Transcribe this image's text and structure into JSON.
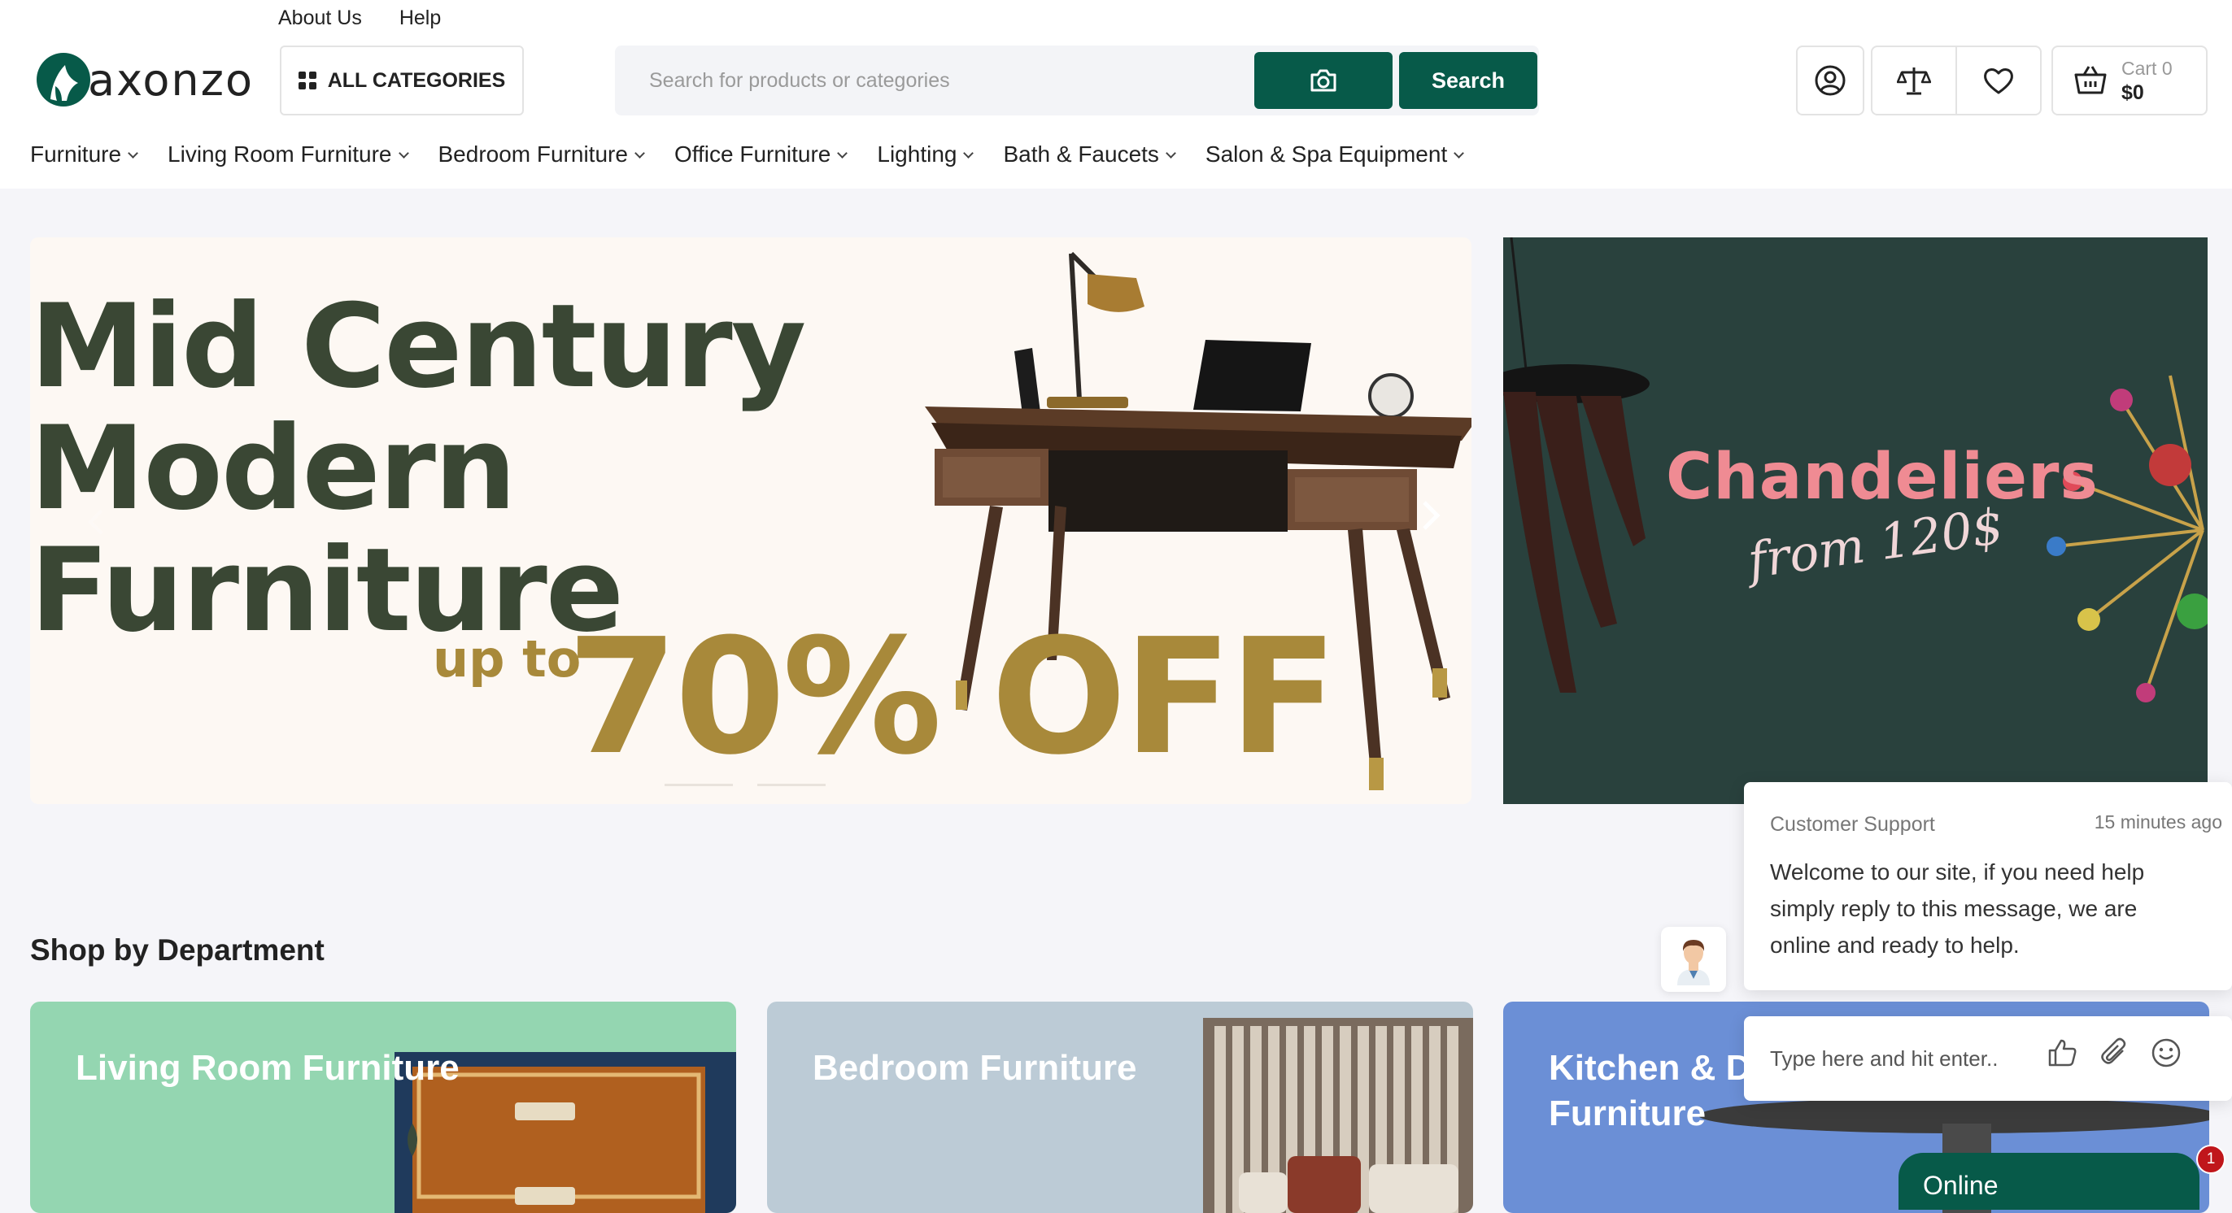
{
  "top_links": {
    "about": "About Us",
    "help": "Help"
  },
  "logo": {
    "text": "axonzo",
    "icon": "logo-mark-icon"
  },
  "all_categories": {
    "label": "ALL CATEGORIES",
    "icon": "grid-icon"
  },
  "search": {
    "placeholder": "Search for products or categories",
    "camera_icon": "camera-icon",
    "button_label": "Search"
  },
  "header_icons": {
    "account": "user-icon",
    "compare": "scale-icon",
    "wishlist": "heart-icon"
  },
  "cart": {
    "count_label": "Cart 0",
    "total": "$0",
    "icon": "basket-icon"
  },
  "nav": [
    {
      "label": "Furniture"
    },
    {
      "label": "Living Room Furniture"
    },
    {
      "label": "Bedroom Furniture"
    },
    {
      "label": "Office Furniture"
    },
    {
      "label": "Lighting"
    },
    {
      "label": "Bath & Faucets"
    },
    {
      "label": "Salon & Spa Equipment"
    }
  ],
  "hero": {
    "title": "Mid Century\nModern\nFurniture",
    "upto": "up to",
    "discount": "70% OFF"
  },
  "promo": {
    "title": "Chandeliers",
    "subtitle": "from 120$"
  },
  "section_title": "Shop by Department",
  "departments": [
    {
      "title": "Living Room Furniture"
    },
    {
      "title": "Bedroom Furniture"
    },
    {
      "title": "Kitchen & Di\nFurniture"
    }
  ],
  "chat": {
    "sender": "Customer Support",
    "time": "15 minutes ago",
    "message": "Welcome to our site, if you need help simply reply to this message, we are online and ready to help.",
    "input_placeholder": "Type here and hit enter..",
    "online_label": "Online",
    "badge": "1"
  },
  "colors": {
    "brand": "#075a49",
    "hero_title": "#3a4734",
    "hero_accent": "#a8893a",
    "promo_bg": "#29413d",
    "promo_title": "#ef8b93",
    "badge": "#c0161b"
  }
}
